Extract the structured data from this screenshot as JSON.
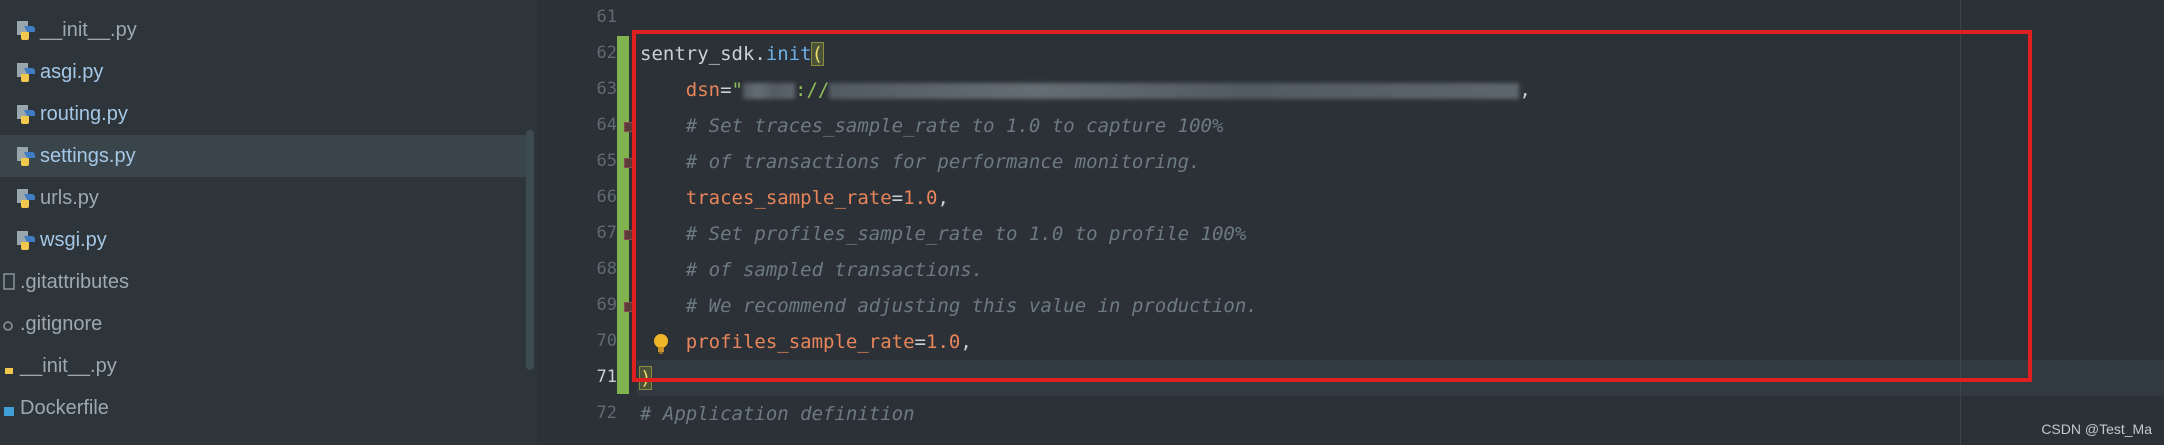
{
  "sidebar": {
    "items": [
      {
        "label": "__init__.py",
        "kind": "python"
      },
      {
        "label": "asgi.py",
        "kind": "python"
      },
      {
        "label": "routing.py",
        "kind": "python"
      },
      {
        "label": "settings.py",
        "kind": "python",
        "selected": true
      },
      {
        "label": "urls.py",
        "kind": "python"
      },
      {
        "label": "wsgi.py",
        "kind": "python"
      },
      {
        "label": ".gitattributes",
        "kind": "plain"
      },
      {
        "label": ".gitignore",
        "kind": "plain"
      },
      {
        "label": "__init__.py",
        "kind": "python"
      },
      {
        "label": "Dockerfile",
        "kind": "docker"
      }
    ]
  },
  "editor": {
    "line_numbers": [
      "61",
      "62",
      "63",
      "64",
      "65",
      "66",
      "67",
      "68",
      "69",
      "70",
      "71",
      "72"
    ],
    "current_line": "71",
    "lines": {
      "l62_obj": "sentry_sdk",
      "l62_dot": ".",
      "l62_fn": "init",
      "l62_paren": "(",
      "l63_param": "dsn",
      "l63_eq": "=",
      "l63_str_open": "\"",
      "l63_str_mid": "://",
      "l63_tail": ",",
      "l64_comment": "# Set traces_sample_rate to 1.0 to capture 100%",
      "l65_comment": "# of transactions for performance monitoring.",
      "l66_param": "traces_sample_rate",
      "l66_eq": "=",
      "l66_num": "1.0",
      "l66_tail": ",",
      "l67_comment": "# Set profiles_sample_rate to 1.0 to profile 100%",
      "l68_comment": "# of sampled transactions.",
      "l69_comment": "# We recommend adjusting this value in production.",
      "l70_param": "profiles_sample_rate",
      "l70_eq": "=",
      "l70_num": "1.0",
      "l70_tail": ",",
      "l71_paren": ")",
      "l72_comment": "# Application definition"
    }
  },
  "watermark": "CSDN @Test_Ma",
  "colors": {
    "background": "#2b3136",
    "change_bar": "#7fb34f",
    "highlight_box": "#e02020",
    "string": "#8fbf5a",
    "param": "#e8855a",
    "function": "#6cb0e8",
    "comment": "#6d7a83"
  },
  "icons": {
    "python_file": "python-file-icon",
    "plain_file": "text-file-icon",
    "docker_file": "docker-file-icon",
    "intention_bulb": "lightbulb-icon",
    "fold": "fold-marker-icon"
  }
}
